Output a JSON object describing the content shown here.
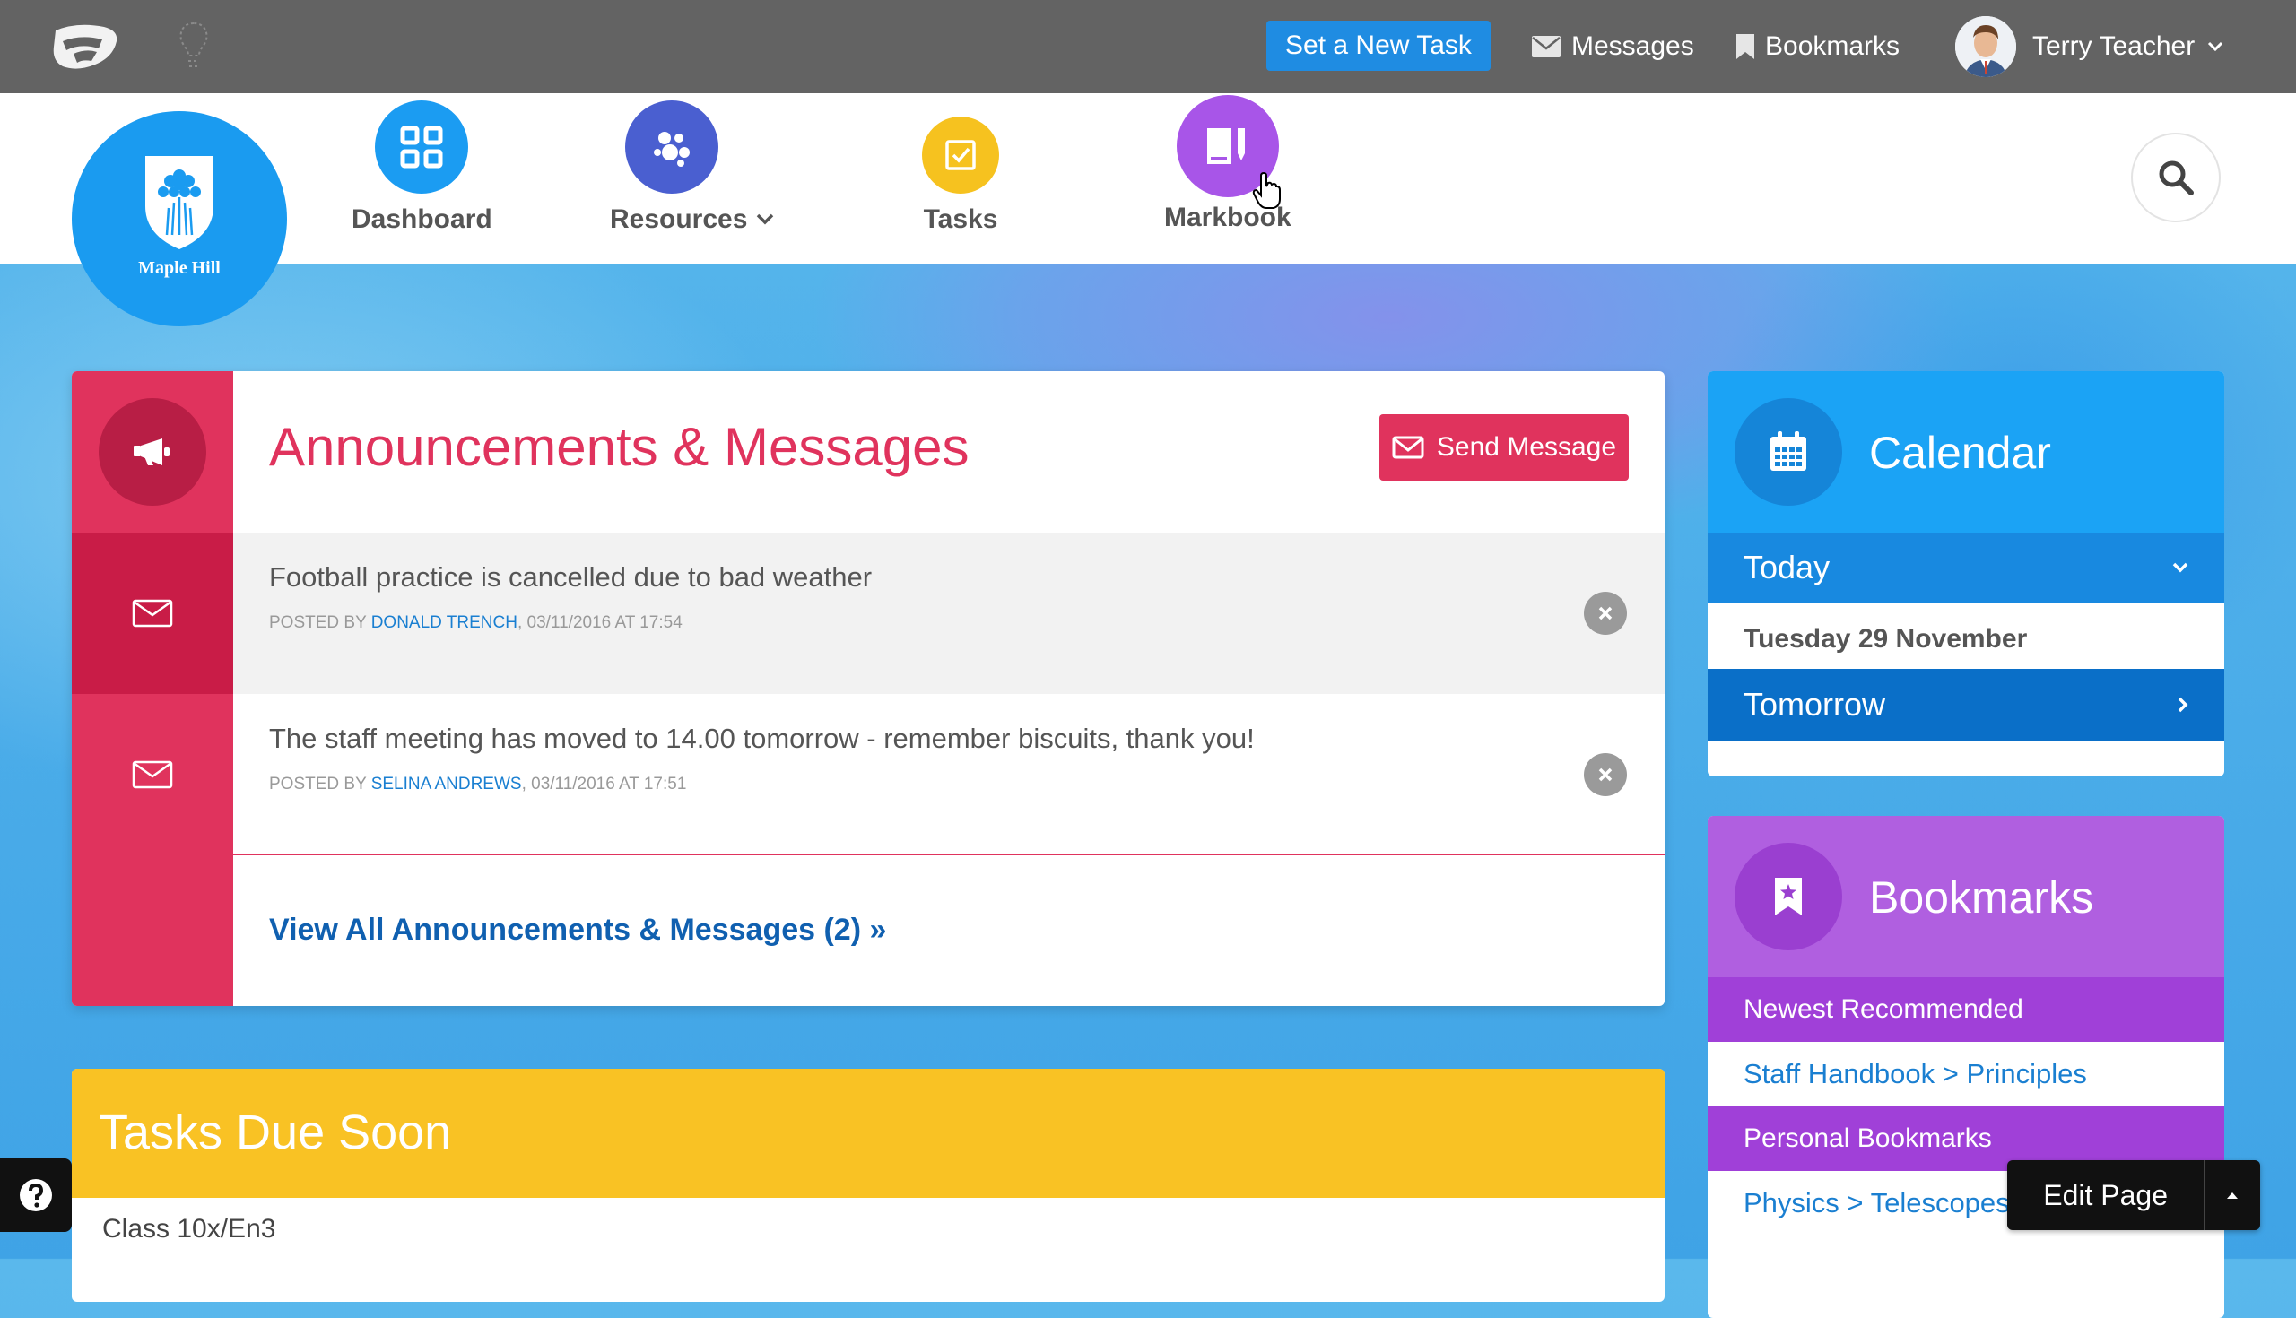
{
  "topbar": {
    "new_task_label": "Set a New Task",
    "messages_label": "Messages",
    "bookmarks_label": "Bookmarks",
    "user_name": "Terry Teacher"
  },
  "school": {
    "name": "Maple Hill"
  },
  "nav": {
    "items": [
      {
        "label": "Dashboard",
        "color": "#1b9cf2",
        "icon": "dashboard-grid-icon"
      },
      {
        "label": "Resources",
        "color": "#4a5fd0",
        "icon": "resources-icon"
      },
      {
        "label": "Tasks",
        "color": "#f6c21f",
        "icon": "tasks-checkbox-icon"
      },
      {
        "label": "Markbook",
        "color": "#a855e8",
        "icon": "markbook-icon"
      }
    ]
  },
  "announcements": {
    "title": "Announcements & Messages",
    "send_label": "Send Message",
    "posted_by_prefix": "POSTED BY",
    "messages": [
      {
        "text": "Football practice is cancelled due to bad weather",
        "author": "DONALD TRENCH",
        "date": ", 03/11/2016 AT 17:54"
      },
      {
        "text": "The staff meeting has moved to 14.00 tomorrow - remember biscuits, thank you!",
        "author": "SELINA ANDREWS",
        "date": ", 03/11/2016 AT 17:51"
      }
    ],
    "view_all": "View All Announcements & Messages (2) »"
  },
  "tasks_panel": {
    "title": "Tasks Due Soon",
    "rows": [
      "Class 10x/En3"
    ]
  },
  "calendar": {
    "title": "Calendar",
    "today_label": "Today",
    "today_date": "Tuesday 29 November",
    "tomorrow_label": "Tomorrow"
  },
  "bookmarks_panel": {
    "title": "Bookmarks",
    "sections": [
      {
        "label": "Newest Recommended",
        "link": "Staff Handbook > Principles"
      },
      {
        "label": "Personal Bookmarks",
        "link": "Physics > Telescopes"
      }
    ]
  },
  "edit_page_label": "Edit Page",
  "colors": {
    "announcement": "#e0335d",
    "calendar": "#1ba3f5",
    "bookmarks": "#b05fe0",
    "tasks": "#f9c224"
  }
}
